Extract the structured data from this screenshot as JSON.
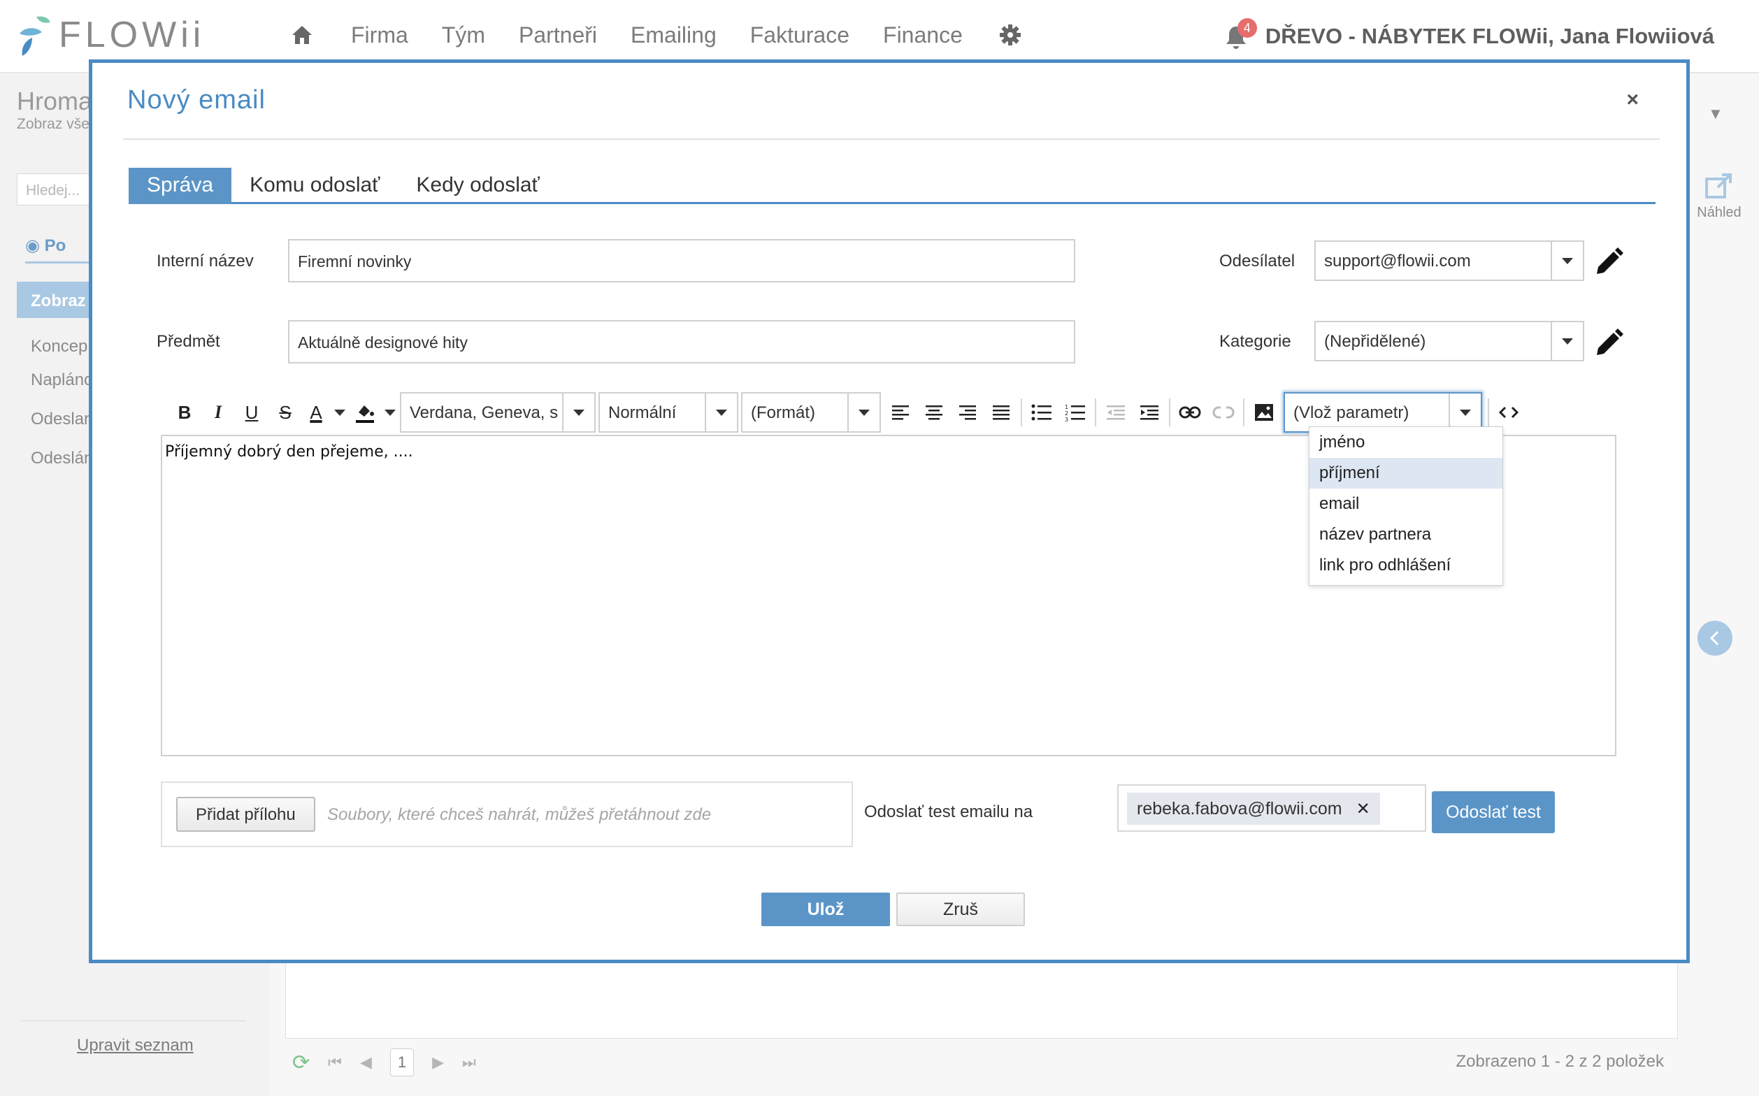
{
  "app": {
    "logo_text": "FLOWii",
    "nav_items": [
      "Firma",
      "Tým",
      "Partneři",
      "Emailing",
      "Fakturace",
      "Finance"
    ],
    "notification_count": "4",
    "user": "DŘEVO - NÁBYTEK FLOWii, Jana Flowiiová",
    "accent_color": "#4a8bc4"
  },
  "background": {
    "title": "Hroma",
    "subtitle": "Zobraz vše",
    "search_placeholder": "Hledej...",
    "tab_label": "Po",
    "active_item": "Zobraz",
    "list_items": [
      "Koncep",
      "Naplánc",
      "Odeslan",
      "Odeslán"
    ],
    "edit_link": "Upravit seznam",
    "preview_label": "Náhled",
    "page_number": "1",
    "count_text": "Zobrazeno 1 - 2 z 2 položek"
  },
  "modal": {
    "title": "Nový email",
    "close": "×",
    "tabs": [
      "Správa",
      "Komu odoslať",
      "Kedy odoslať"
    ],
    "fields": {
      "internal_name_label": "Interní název",
      "internal_name_value": "Firemní novinky",
      "subject_label": "Předmět",
      "subject_value": "Aktuálně designové hity",
      "sender_label": "Odesílatel",
      "sender_value": "support@flowii.com",
      "category_label": "Kategorie",
      "category_value": "(Nepřidělené)"
    },
    "toolbar": {
      "bold": "B",
      "italic": "I",
      "underline": "U",
      "strike": "S",
      "font_color": "A",
      "font_family": "Verdana, Geneva, s",
      "font_size": "Normální",
      "format": "(Formát)",
      "param": "(Vlož parametr)"
    },
    "editor_text": "Příjemný dobrý den přejeme, ....",
    "param_options": [
      "jméno",
      "příjmení",
      "email",
      "název partnera",
      "link pro odhlášení"
    ],
    "attach_button": "Přidat přílohu",
    "attach_hint": "Soubory, které chceš nahrát, můžeš přetáhnout zde",
    "test_label": "Odoslať test emailu na",
    "test_email": "rebeka.fabova@flowii.com",
    "test_button": "Odoslať test",
    "save_button": "Ulož",
    "cancel_button": "Zruš"
  }
}
